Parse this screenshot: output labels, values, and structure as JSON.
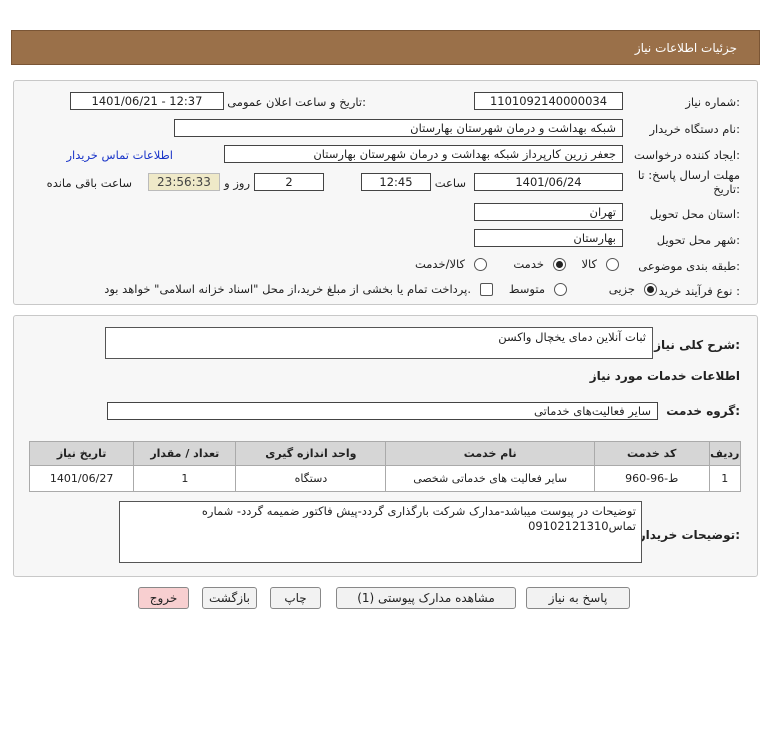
{
  "header": {
    "title": "جزئیات اطلاعات نیاز"
  },
  "info": {
    "need_number_label": "شماره نیاز:",
    "need_number": "1101092140000034",
    "announce_label": "تاریخ و ساعت اعلان عمومی:",
    "announce_value": "1401/06/21 - 12:37",
    "buyer_label": "نام دستگاه خریدار:",
    "buyer_value": "شبکه بهداشت و درمان شهرستان بهارستان",
    "creator_label": "ایجاد کننده درخواست:",
    "creator_value": "جعفر زرین کارپرداز شبکه بهداشت و درمان شهرستان بهارستان",
    "contact_link": "اطلاعات تماس خریدار",
    "deadline_label_1": "مهلت ارسال پاسخ: تا",
    "deadline_label_2": "تاریخ:",
    "deadline_date": "1401/06/24",
    "time_label": "ساعت",
    "deadline_time": "12:45",
    "days_value": "2",
    "days_label": "روز و",
    "remaining_time": "23:56:33",
    "remaining_label": "ساعت باقی مانده",
    "province_label": "استان محل تحویل:",
    "province_value": "تهران",
    "city_label": "شهر محل تحویل:",
    "city_value": "بهارستان",
    "category_label": "طبقه بندی موضوعی:",
    "category_options": [
      "کالا",
      "خدمت",
      "کالا/خدمت"
    ],
    "category_selected": "خدمت",
    "process_label": "نوع فرآیند خرید :",
    "process_options": [
      "جزیی",
      "متوسط"
    ],
    "process_selected": "جزیی",
    "treasury_note": "پرداخت تمام یا بخشی از مبلغ خرید،از محل \"اسناد خزانه اسلامی\" خواهد بود."
  },
  "need": {
    "summary_label": "شرح کلی نیاز:",
    "summary_value": "ثبات آنلاین دمای یخچال واکسن",
    "services_title": "اطلاعات خدمات مورد نیاز",
    "group_label": "گروه خدمت:",
    "group_value": "سایر فعالیت‌های خدماتی",
    "table": {
      "headers": [
        "ردیف",
        "کد خدمت",
        "نام خدمت",
        "واحد اندازه گیری",
        "تعداد / مقدار",
        "تاریخ نیاز"
      ],
      "rows": [
        [
          "1",
          "ط-96-960",
          "سایر فعالیت های خدماتی شخصی",
          "دستگاه",
          "1",
          "1401/06/27"
        ]
      ]
    },
    "buyer_notes_label": "توضیحات خریدار:",
    "buyer_notes": "توضیحات در پیوست میباشد-مدارک شرکت بارگذاری گردد-پیش فاکتور ضمیمه گردد- شماره تماس09102121310"
  },
  "buttons": {
    "reply": "پاسخ به نیاز",
    "attachments": "مشاهده مدارک پیوستی (1)",
    "print": "چاپ",
    "back": "بازگشت",
    "exit": "خروج"
  },
  "colors": {
    "header_bg": "#9a7049",
    "link": "#1a35c8",
    "exit_bg": "#f8cfd0",
    "timer_bg": "#efe9c8"
  }
}
